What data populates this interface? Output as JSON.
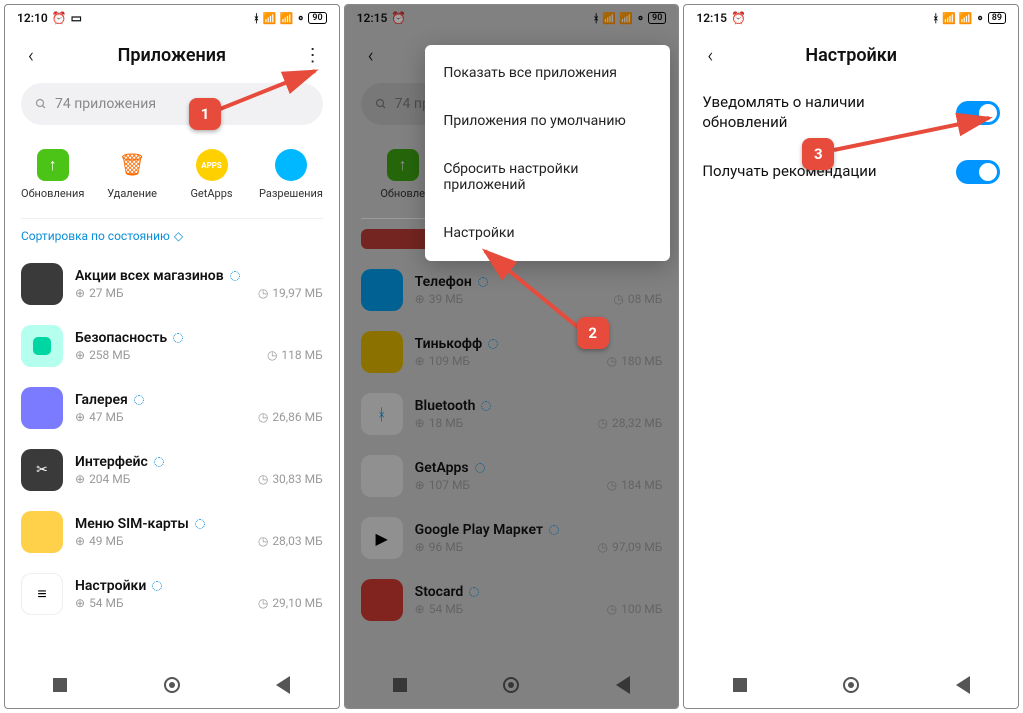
{
  "status": {
    "time1": "12:10",
    "time2": "12:15",
    "time3": "12:15",
    "battery1": "90",
    "battery2": "90",
    "battery3": "89"
  },
  "screen1": {
    "title": "Приложения",
    "search_placeholder": "74 приложения",
    "actions": [
      {
        "label": "Обновления",
        "color": "#4cc417"
      },
      {
        "label": "Удаление",
        "color": "#ff8a00"
      },
      {
        "label": "GetApps",
        "color": "#ffd000"
      },
      {
        "label": "Разрешения",
        "color": "#00b8ff"
      }
    ],
    "sort_label": "Сортировка по состоянию",
    "apps": [
      {
        "name": "Акции всех магазинов",
        "size": "27 МБ",
        "storage": "19,97 МБ",
        "bg": "#3a3a3a"
      },
      {
        "name": "Безопасность",
        "size": "258 МБ",
        "storage": "118 МБ",
        "bg": "#2ae8b7"
      },
      {
        "name": "Галерея",
        "size": "47 МБ",
        "storage": "26,86 МБ",
        "bg": "#7b7bff"
      },
      {
        "name": "Интерфейс",
        "size": "204 МБ",
        "storage": "30,83 МБ",
        "bg": "#3a3a3a"
      },
      {
        "name": "Меню SIM-карты",
        "size": "49 МБ",
        "storage": "28,03 МБ",
        "bg": "#ffd04a"
      },
      {
        "name": "Настройки",
        "size": "54 МБ",
        "storage": "29,10 МБ",
        "bg": "#ffffff"
      }
    ]
  },
  "screen2": {
    "title": "",
    "search_placeholder": "74 пр",
    "menu": [
      "Показать все приложения",
      "Приложения по умолчанию",
      "Сбросить настройки приложений",
      "Настройки"
    ],
    "action_label": "Обновле",
    "apps": [
      {
        "name": "Телефон",
        "size": "39 МБ",
        "storage": "08 МБ",
        "bg": "#00b8ff"
      },
      {
        "name": "Тинькофф",
        "size": "109 МБ",
        "storage": "180 МБ",
        "bg": "#ffd100"
      },
      {
        "name": "Bluetooth",
        "size": "18 МБ",
        "storage": "28,32 МБ",
        "bg": "#ffffff"
      },
      {
        "name": "GetApps",
        "size": "107 МБ",
        "storage": "184 МБ",
        "bg": "#ffffff"
      },
      {
        "name": "Google Play Маркет",
        "size": "96 МБ",
        "storage": "97,09 МБ",
        "bg": "#ffffff"
      },
      {
        "name": "Stocard",
        "size": "54 МБ",
        "storage": "100 МБ",
        "bg": "#e6433c"
      }
    ]
  },
  "screen3": {
    "title": "Настройки",
    "settings": [
      {
        "label": "Уведомлять о наличии обновлений",
        "on": true
      },
      {
        "label": "Получать рекомендации",
        "on": true
      }
    ]
  },
  "badges": {
    "b1": "1",
    "b2": "2",
    "b3": "3"
  },
  "units": {
    "mb": "МБ"
  }
}
